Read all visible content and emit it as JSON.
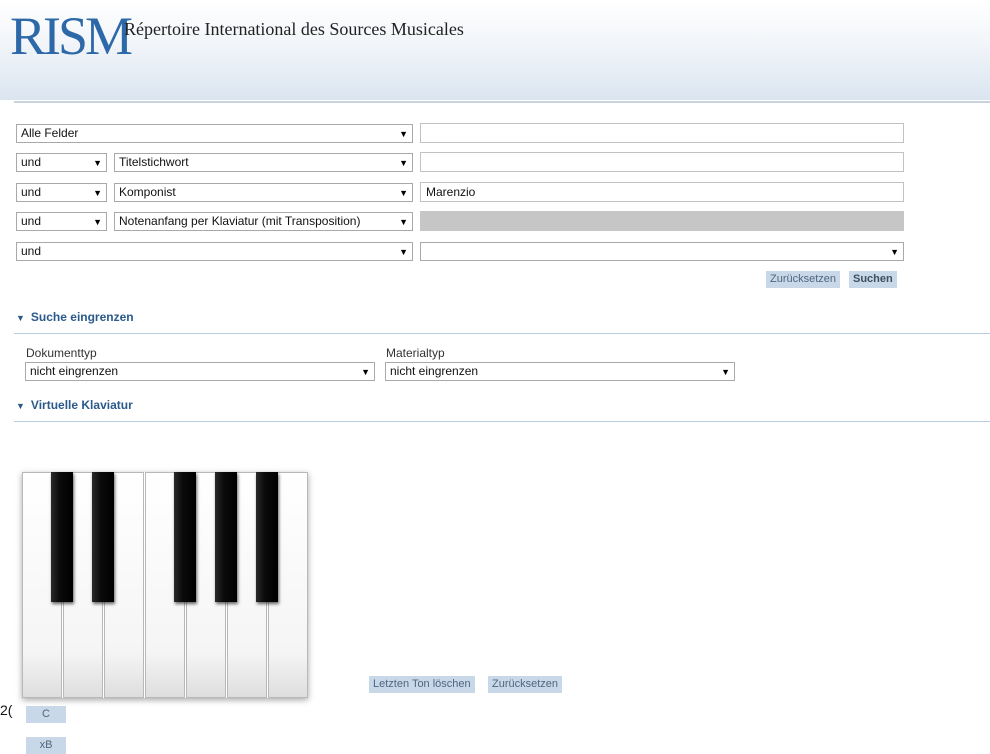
{
  "header": {
    "logo_text": "RISM",
    "site_title": "Répertoire International des Sources Musicales"
  },
  "search_rows": [
    {
      "operator": null,
      "field": "Alle Felder",
      "value": ""
    },
    {
      "operator": "und",
      "field": "Titelstichwort",
      "value": ""
    },
    {
      "operator": "und",
      "field": "Komponist",
      "value": "Marenzio"
    },
    {
      "operator": "und",
      "field": "Notenanfang per Klaviatur (mit Transposition)",
      "value": "",
      "disabled": true
    },
    {
      "operator": "und",
      "field": null,
      "value": ""
    }
  ],
  "buttons": {
    "reset": "Zurücksetzen",
    "search": "Suchen",
    "delete_last": "Letzten Ton löschen",
    "reset_keyboard": "Zurücksetzen"
  },
  "refine": {
    "title": "Suche eingrenzen",
    "doc_type_label": "Dokumenttyp",
    "doc_type_value": "nicht eingrenzen",
    "material_label": "Materialtyp",
    "material_value": "nicht eingrenzen"
  },
  "keyboard_section": {
    "title": "Virtuelle Klaviatur"
  },
  "keyboard_buttons": {
    "note": "C",
    "accidental": "xB"
  },
  "edge_fragment": "2("
}
